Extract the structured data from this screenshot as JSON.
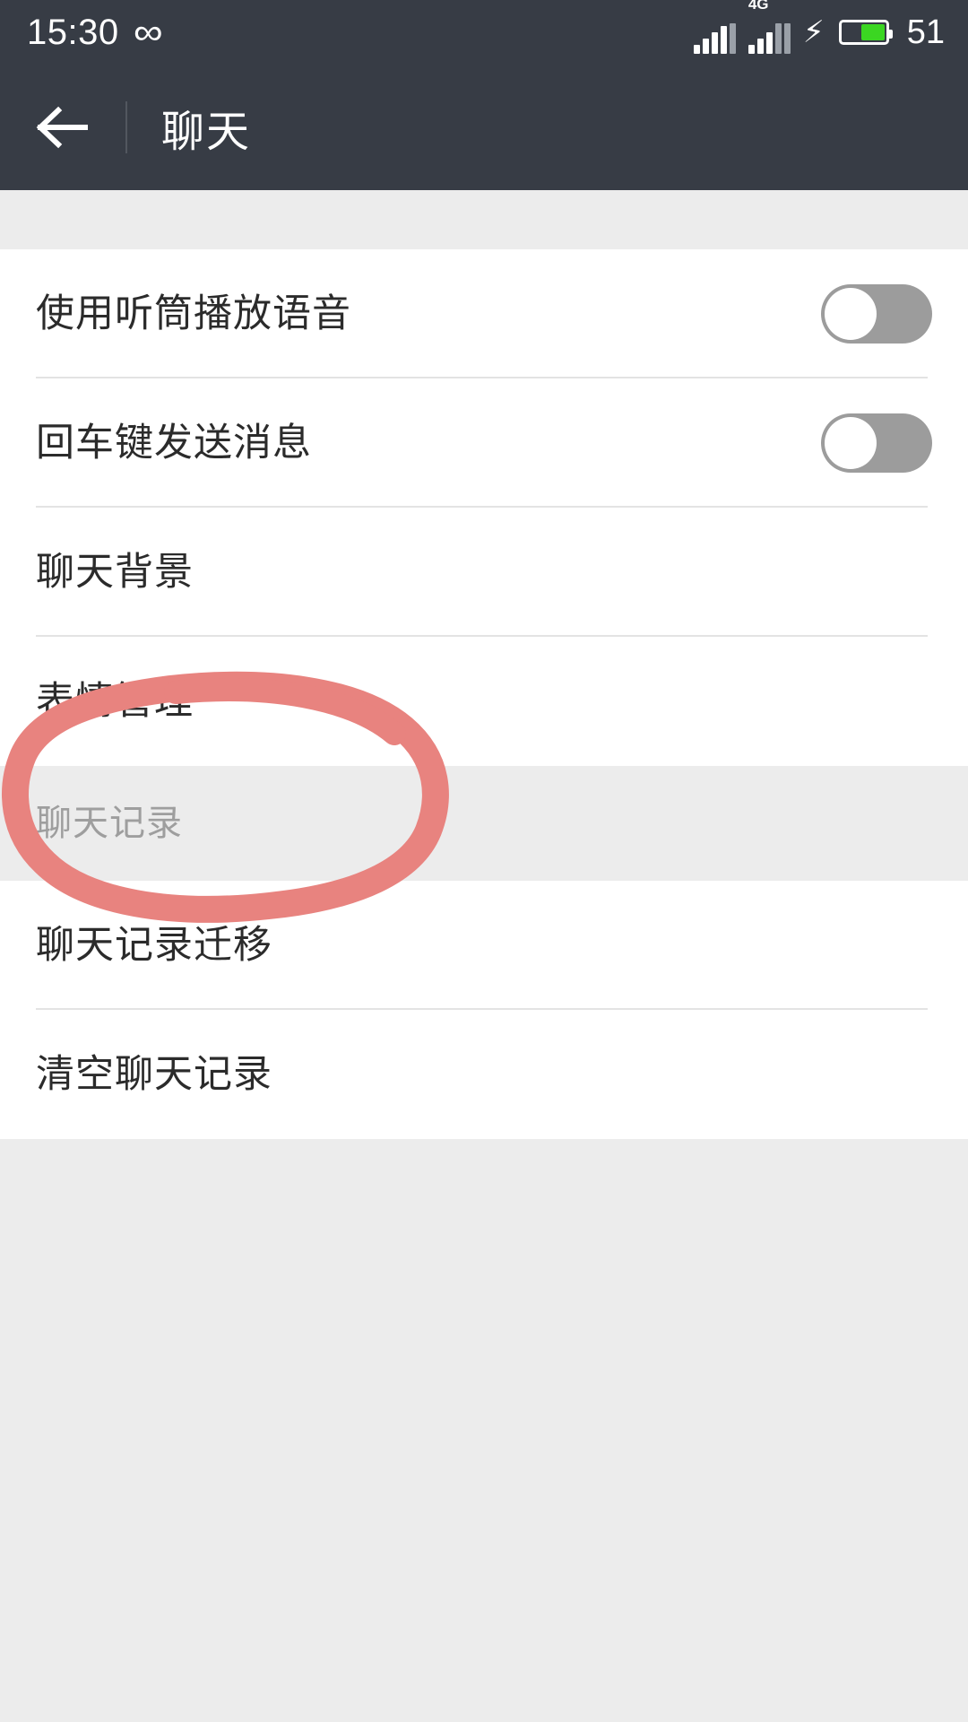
{
  "statusbar": {
    "clock": "15:30",
    "infinity_icon": "∞",
    "network_label": "4G",
    "charging_icon": "⚡",
    "battery_percent": "51",
    "battery_fill_color": "#3bd622",
    "background_color": "#373c45"
  },
  "titlebar": {
    "back_label": "←",
    "title": "聊天",
    "background_color": "#373c45"
  },
  "settings": {
    "group_one": [
      {
        "label": "使用听筒播放语音",
        "type": "toggle",
        "value": "off"
      },
      {
        "label": "回车键发送消息",
        "type": "toggle",
        "value": "off"
      },
      {
        "label": "聊天背景",
        "type": "link"
      },
      {
        "label": "表情管理",
        "type": "link"
      }
    ],
    "section_header": "聊天记录",
    "group_two": [
      {
        "label": "聊天记录迁移",
        "type": "link"
      },
      {
        "label": "清空聊天记录",
        "type": "link"
      }
    ]
  },
  "annotation": {
    "shape": "hand-drawn-ellipse",
    "color": "#e8837f",
    "target_label": "聊天记录迁移"
  },
  "colors": {
    "page_background": "#ececec",
    "card_background": "#ffffff",
    "divider": "#e3e3e3",
    "primary_text": "#2b2b2b",
    "muted_text": "#9e9e9e",
    "toggle_off": "#9c9c9c"
  }
}
